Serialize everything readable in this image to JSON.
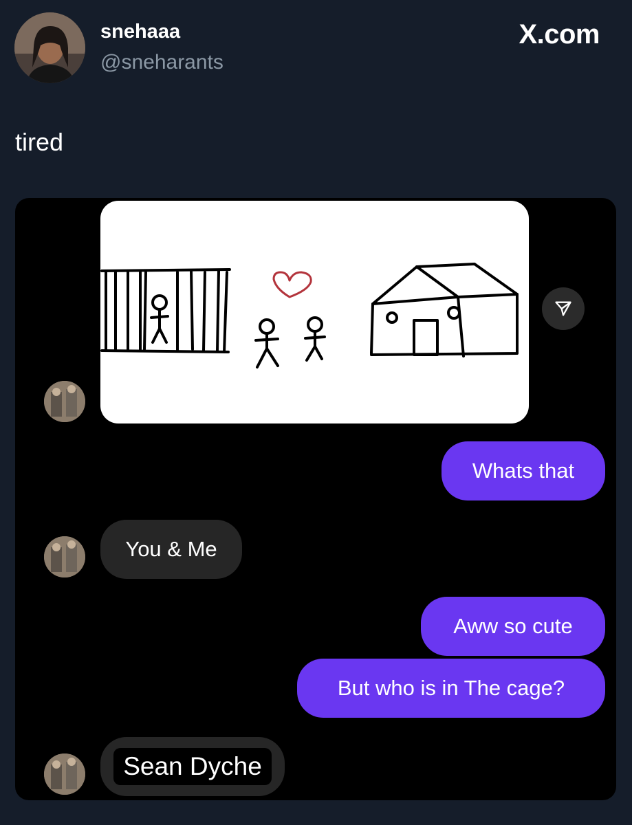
{
  "post": {
    "display_name": "snehaaa",
    "handle": "@sneharants",
    "site_mark": "X.com",
    "text": "tired"
  },
  "chat": {
    "messages": [
      {
        "side": "sent",
        "text": "Whats that"
      },
      {
        "side": "received",
        "text": "You & Me"
      },
      {
        "side": "sent",
        "text": "Aww so cute"
      },
      {
        "side": "sent",
        "text": "But who is in The cage?"
      },
      {
        "side": "received",
        "text": "Sean Dyche"
      }
    ]
  },
  "icons": {
    "share": "send-arrow-icon"
  },
  "colors": {
    "page_background": "#151d2a",
    "chat_background": "#000000",
    "sent_bubble": "#6a37f1",
    "received_bubble": "#262626",
    "handle_text": "#8b98a5",
    "heart_stroke": "#b3343c"
  }
}
